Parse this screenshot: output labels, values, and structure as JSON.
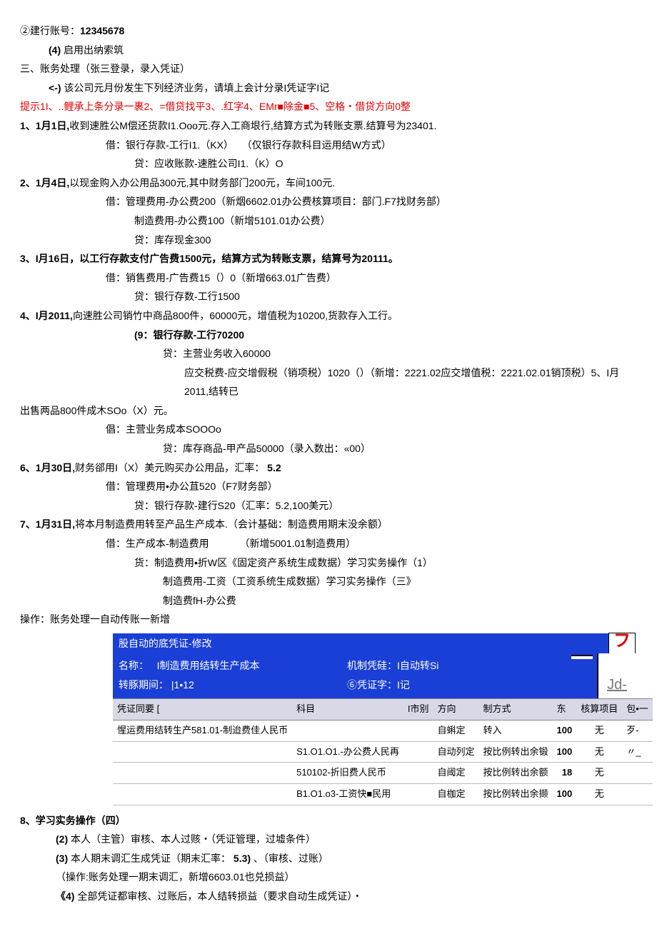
{
  "p1": "②建行账号：",
  "p1b": "12345678",
  "p2a": "(4)",
  "p2b": "启用出纳索筑",
  "p3": "三、账务处理（张三登录，录入凭证）",
  "p4a": "<-)",
  "p4b": "该公司元月份发生下列经济业务，请填上会计分录I凭证字I记",
  "p5": "提示1I、..鲤承上条分录一裹2、=借贷找平3、.红字4、EMr■除金■5、空格・借贷方向0整",
  "e1": {
    "head_a": "1、1月1日,",
    "head_b": "收到速胜公M偿还货款I1.Ooo元.存入工商垠行,结算方式为转账支票.结算号为23401.",
    "l1a": "借：银行存款-工行I1.（KX）",
    "l1b": "（仅银行存款科目运用结W方式）",
    "l2": "贷：应收账款-速胜公司I1.（K）O"
  },
  "e2": {
    "head_a": "2、1月4日,",
    "head_b": "以现金购入办公用品300元,其中财务部门200元，车间100元.",
    "l1": "借：管理费用-办公费200（新烟6602.01办公费核算项目：部门.F7找财务部）",
    "l2": "制造费用-办公费100（新增5101.01办公费）",
    "l3": "贷：库存现金300"
  },
  "e3": {
    "head_a": "3、I月16日，以工行存款支付广告费1500元，结算方式为转账支票，结算号为20111。",
    "l1": "借：销售费用-广告费15（）0（新增663.01广告费）",
    "l2": "贷：银行存数-工行1500"
  },
  "e4": {
    "head_a": "4、I月2011,",
    "head_b": "向速胜公司销竹中商品800件，60000元，增值税为10200,货款存入工行。",
    "l1": "(9：银行存款-工行70200",
    "l2": "贷：主营业务收入60000",
    "l3": "应交税费-应交增假税（销项税）1020（）（新增：2221.02应交增值税：2221.02.01销顶税）5、I月2011,结转已",
    "tail": "出售两品800件成木SOo（X）元。",
    "l4": "倡：主营业务成本SOOOo",
    "l5": "贷：库存商品-甲产品50000（录入数出：«00）"
  },
  "e6": {
    "head_a": "6、1月30日,",
    "head_b": "财务郤用I（X）美元购买办公用品，汇率：",
    "head_c": "5.2",
    "l1": "借：管理费用•办公苴520（F7财务部）",
    "l2": "贷：银行存款-建行S20（汇率：5.2,100美元）"
  },
  "e7": {
    "head_a": "7、1月31日,",
    "head_b": "将本月制造费用转至产品生产成本.（会计基础：制造费用期末没余额）",
    "l1a": "借：生产成本-制造费用",
    "l1b": "（新增5001.01制造费用）",
    "l2": "货：制造费用•折W区《固定资产系统生成数据）学习实务操作（1）",
    "l3": "制造费用-工资（工资系统生成数据）学习实务操作（三》",
    "l4": "制造费fH-办公费"
  },
  "op": "操作：账务处理一自动传账一新增",
  "blue": {
    "bar_title": "股自动的底凭证-修改",
    "z": "フ",
    "name_lab": "名称：",
    "name_val": "I制造费用结转生产成本",
    "mech_lab": "机制凭硅：I自动转Si",
    "period_lab": "转豚期间：",
    "period_val": "|1•12",
    "vz_lab": "⑥凭证字：I记",
    "jd": "Jd-"
  },
  "thdr": {
    "c1": "凭证同要 [",
    "c2": "科目",
    "c3": "I市别",
    "c4": "方向",
    "c5": "制方式",
    "c6": "东",
    "c7": "核算项目",
    "c8": "包•一"
  },
  "rows": [
    {
      "a": "惺运费用结转生产581.01-制迨费佳人民币",
      "b": "",
      "c": "",
      "d": "自蝌定",
      "e": "转入",
      "f": "100",
      "g": "无",
      "h": "歹-"
    },
    {
      "a": "",
      "b": "S1.O1.O1.-办公费人民再",
      "c": "",
      "d": "自动列定",
      "e": "按比例转出余锻",
      "f": "100",
      "g": "无",
      "h": "〃_"
    },
    {
      "a": "",
      "b": "510102-折旧费人民币",
      "c": "",
      "d": "自阈定",
      "e": "按比例转出余额",
      "f": "18",
      "g": "无",
      "h": ""
    },
    {
      "a": "",
      "b": "B1.O1.o3-工资快■民用",
      "c": "",
      "d": "自枷定",
      "e": "按比例转出余撷",
      "f": "100",
      "g": "无",
      "h": ""
    }
  ],
  "e8": {
    "head": "8、学习实务操作（四）",
    "l1a": "(2)",
    "l1b": "本人（主管）审核、本人过赅・（凭证管理，过墟条件）",
    "l2a": "(3)",
    "l2b": "本人期末调汇生成凭证（期末汇率：",
    "l2c": "5.3)",
    "l2d": "、（审核、过账）",
    "l3": "（操作:账务处理一期末调汇，新增6603.01也兑损益）",
    "l4a": "《4)",
    "l4b": "全部凭证都审核、过账后，本人结转损益（要求自动生成凭证）・"
  }
}
